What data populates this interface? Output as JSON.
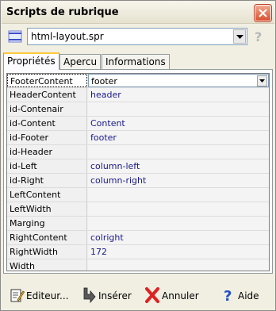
{
  "window": {
    "title": "Scripts de rubrique"
  },
  "script_select": {
    "value": "html-layout.spr"
  },
  "help_mark": "?",
  "tabs": [
    {
      "label": "Propriétés",
      "active": true
    },
    {
      "label": "Apercu",
      "active": false
    },
    {
      "label": "Informations",
      "active": false
    }
  ],
  "properties": [
    {
      "name": "FooterContent",
      "value": "footer"
    },
    {
      "name": "HeaderContent",
      "value": "header"
    },
    {
      "name": "id-Contenair",
      "value": ""
    },
    {
      "name": "id-Content",
      "value": "Content"
    },
    {
      "name": "id-Footer",
      "value": "footer"
    },
    {
      "name": "id-Header",
      "value": ""
    },
    {
      "name": "id-Left",
      "value": "column-left"
    },
    {
      "name": "id-Right",
      "value": "column-right"
    },
    {
      "name": "LeftContent",
      "value": ""
    },
    {
      "name": "LeftWidth",
      "value": ""
    },
    {
      "name": "Marging",
      "value": ""
    },
    {
      "name": "RightContent",
      "value": "colright"
    },
    {
      "name": "RightWidth",
      "value": "172"
    },
    {
      "name": "Width",
      "value": ""
    }
  ],
  "footer_buttons": {
    "editor": "Editeur...",
    "insert": "Insérer",
    "cancel": "Annuler",
    "help": "Aide"
  }
}
